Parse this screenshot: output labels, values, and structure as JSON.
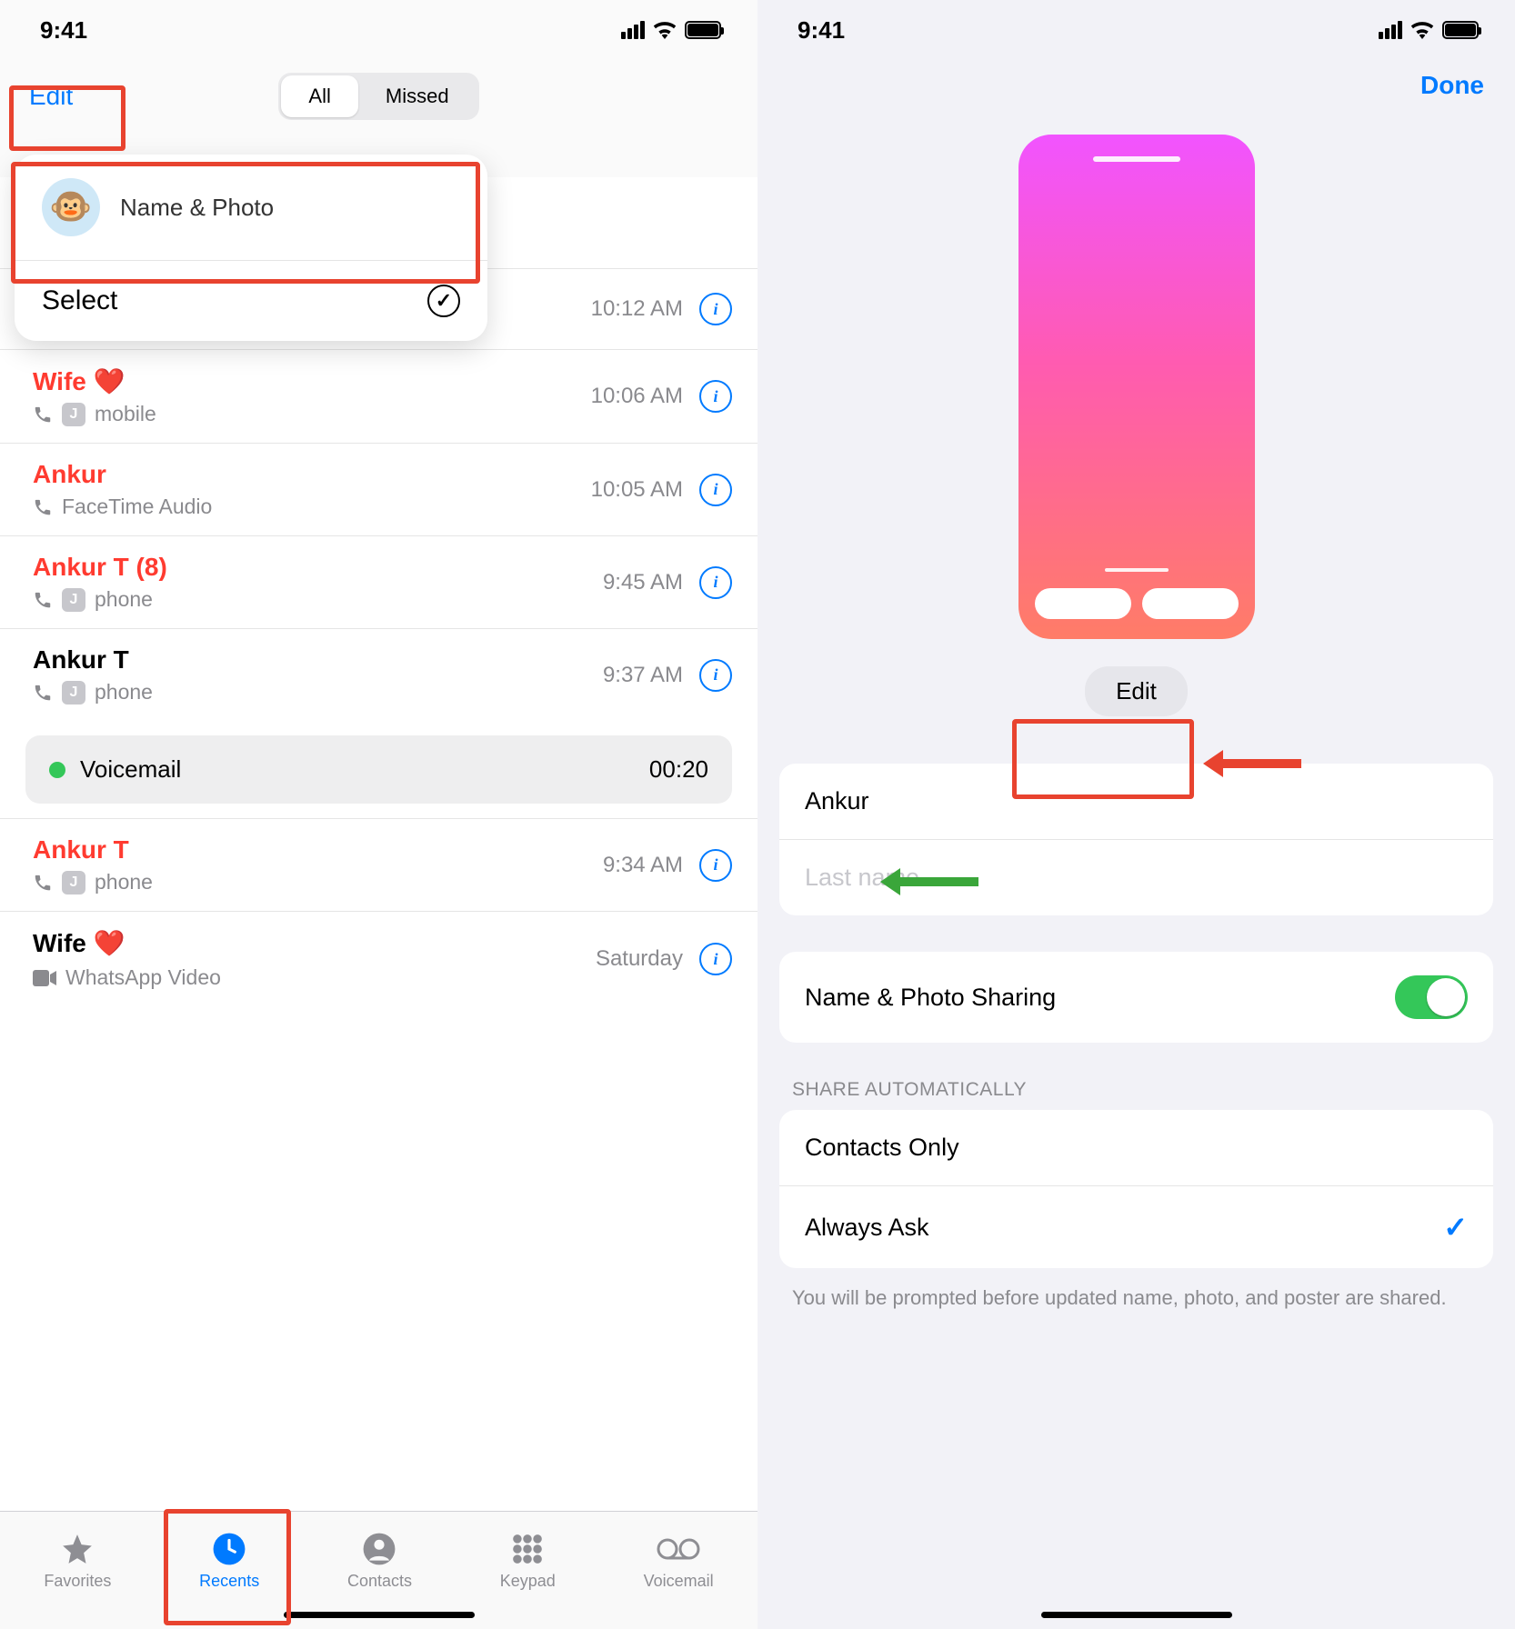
{
  "status": {
    "time": "9:41"
  },
  "left": {
    "edit": "Edit",
    "segmented": {
      "all": "All",
      "missed": "Missed"
    },
    "popover": {
      "name_photo": "Name & Photo",
      "select": "Select",
      "avatar_emoji": "🐵"
    },
    "calls": [
      {
        "name": "Wife ❤️",
        "sub": "mobile",
        "time": "10:06 AM",
        "missed": true,
        "badge": "J",
        "icon": "phone-in"
      },
      {
        "name": "Ankur",
        "sub": "FaceTime Audio",
        "time": "10:05 AM",
        "missed": true,
        "icon": "phone-in"
      },
      {
        "name": "Ankur T (8)",
        "sub": "phone",
        "time": "9:45 AM",
        "missed": true,
        "badge": "J",
        "icon": "phone-in"
      },
      {
        "name": "Ankur T",
        "sub": "phone",
        "time": "9:37 AM",
        "missed": false,
        "badge": "J",
        "icon": "phone-in",
        "voicemail": {
          "label": "Voicemail",
          "duration": "00:20"
        }
      },
      {
        "name": "Ankur T",
        "sub": "phone",
        "time": "9:34 AM",
        "missed": true,
        "badge": "J",
        "icon": "phone-in"
      },
      {
        "name": "Wife ❤️",
        "sub": "WhatsApp Video",
        "time": "Saturday",
        "missed": false,
        "icon": "video"
      }
    ],
    "floating_time": "10:12 AM",
    "tabs": {
      "favorites": "Favorites",
      "recents": "Recents",
      "contacts": "Contacts",
      "keypad": "Keypad",
      "voicemail": "Voicemail"
    }
  },
  "right": {
    "done": "Done",
    "edit": "Edit",
    "first_name": "Ankur",
    "last_name_placeholder": "Last name",
    "sharing_label": "Name & Photo Sharing",
    "share_header": "SHARE AUTOMATICALLY",
    "contacts_only": "Contacts Only",
    "always_ask": "Always Ask",
    "footnote": "You will be prompted before updated name, photo, and poster are shared."
  }
}
